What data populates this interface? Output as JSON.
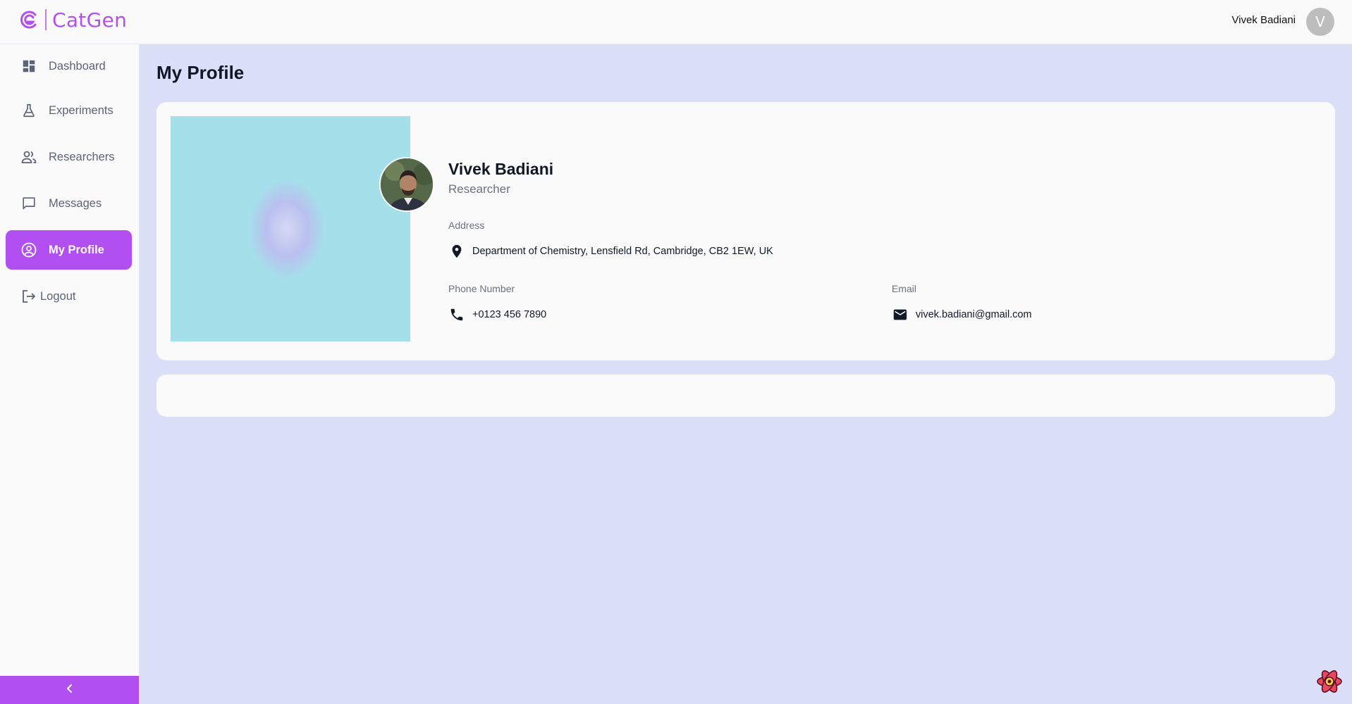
{
  "app": {
    "name": "CatGen",
    "accent_color": "#b14ff0"
  },
  "header": {
    "user_name": "Vivek Badiani",
    "avatar_initial": "V"
  },
  "sidebar": {
    "items": [
      {
        "label": "Dashboard",
        "icon": "dashboard-icon",
        "active": false
      },
      {
        "label": "Experiments",
        "icon": "flask-icon",
        "active": false
      },
      {
        "label": "Researchers",
        "icon": "people-icon",
        "active": false
      },
      {
        "label": "Messages",
        "icon": "chat-icon",
        "active": false
      },
      {
        "label": "My Profile",
        "icon": "account-circle-icon",
        "active": true
      },
      {
        "label": "Logout",
        "icon": "logout-icon",
        "active": false
      }
    ],
    "collapse_icon": "chevron-left-icon"
  },
  "main": {
    "title": "My Profile",
    "profile": {
      "name": "Vivek Badiani",
      "role": "Researcher",
      "address_label": "Address",
      "address": "Department of Chemistry, Lensfield Rd, Cambridge, CB2 1EW, UK",
      "phone_label": "Phone Number",
      "phone": "+0123 456 7890",
      "email_label": "Email",
      "email": "vivek.badiani@gmail.com"
    }
  }
}
